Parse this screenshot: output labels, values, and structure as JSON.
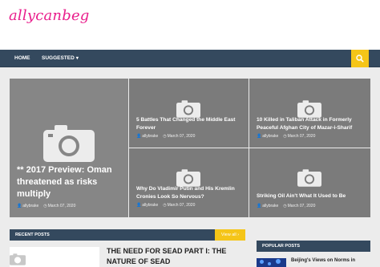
{
  "site": {
    "logo": "allycanbeg"
  },
  "nav": {
    "home": "HOME",
    "suggested": "SUGGESTED",
    "suggested_chevron": "▾",
    "search_icon": "search-icon"
  },
  "featured": {
    "big": {
      "title": "** 2017 Preview: Oman threatened as risks multiply",
      "author": "allybrake",
      "date": "March 07, 2020"
    },
    "s1": {
      "title": "5 Battles That Changed the Middle East Forever",
      "author": "allybrake",
      "date": "March 07, 2020"
    },
    "s2": {
      "title": "10 Killed in Taliban Attack in Formerly Peaceful Afghan City of Mazar-i-Sharif",
      "author": "allybrake",
      "date": "March 07, 2020"
    },
    "s3": {
      "title": "Why Do Vladimir Putin and His Kremlin Cronies Look So Nervous?",
      "author": "allybrake",
      "date": "March 07, 2020"
    },
    "s4": {
      "title": "Striking Oil Ain't What It Used to Be",
      "author": "allybrake",
      "date": "March 07, 2020"
    }
  },
  "icons": {
    "author": "👤",
    "clock": "◷",
    "placeholder": "camera-icon"
  },
  "recent": {
    "title": "RECENT POSTS",
    "view_all": "View all ›",
    "post_title": "THE NEED FOR SEAD PART I: THE NATURE OF SEAD"
  },
  "popular": {
    "title": "POPULAR POSTS",
    "post_title": "Beijing's Views on Norms in"
  },
  "colors": {
    "logo": "#e91e8c",
    "nav_bg": "#34495e",
    "accent": "#f5c518",
    "card_bg": "#7b7b7b"
  }
}
